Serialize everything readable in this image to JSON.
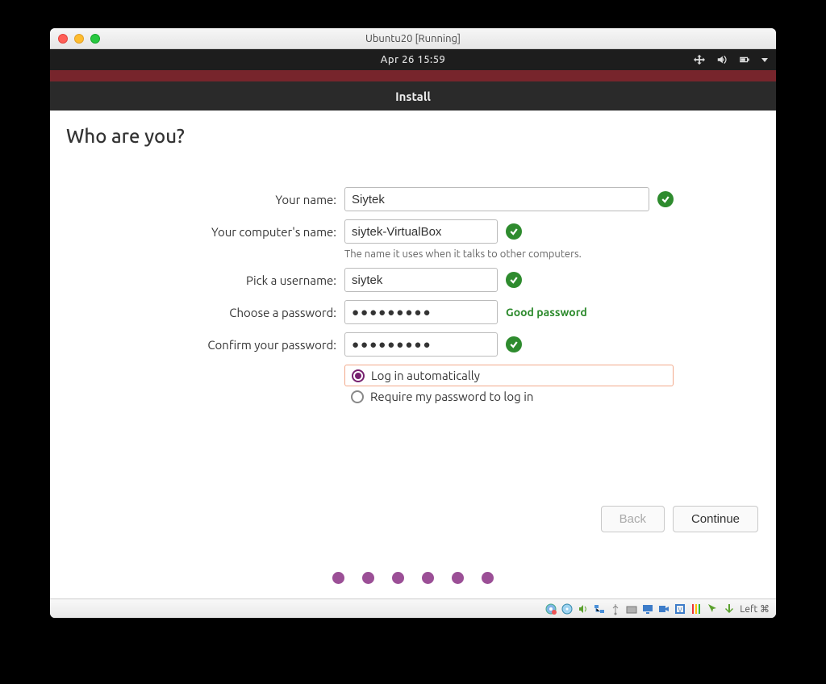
{
  "window": {
    "title": "Ubuntu20  [Running]"
  },
  "panel": {
    "clock": "Apr 26  15:59"
  },
  "installer": {
    "title": "Install",
    "heading": "Who are you?",
    "labels": {
      "name": "Your name:",
      "computer": "Your computer's name:",
      "computer_hint": "The name it uses when it talks to other computers.",
      "username": "Pick a username:",
      "password": "Choose a password:",
      "confirm": "Confirm your password:"
    },
    "values": {
      "name": "Siytek",
      "computer": "siytek-VirtualBox",
      "username": "siytek",
      "password": "●●●●●●●●●",
      "confirm": "●●●●●●●●●"
    },
    "password_strength": "Good password",
    "radios": {
      "auto": "Log in automatically",
      "require": "Require my password to log in",
      "selected": "auto"
    },
    "buttons": {
      "back": "Back",
      "continue": "Continue"
    }
  },
  "vb_status": {
    "host_key": "Left ⌘"
  }
}
